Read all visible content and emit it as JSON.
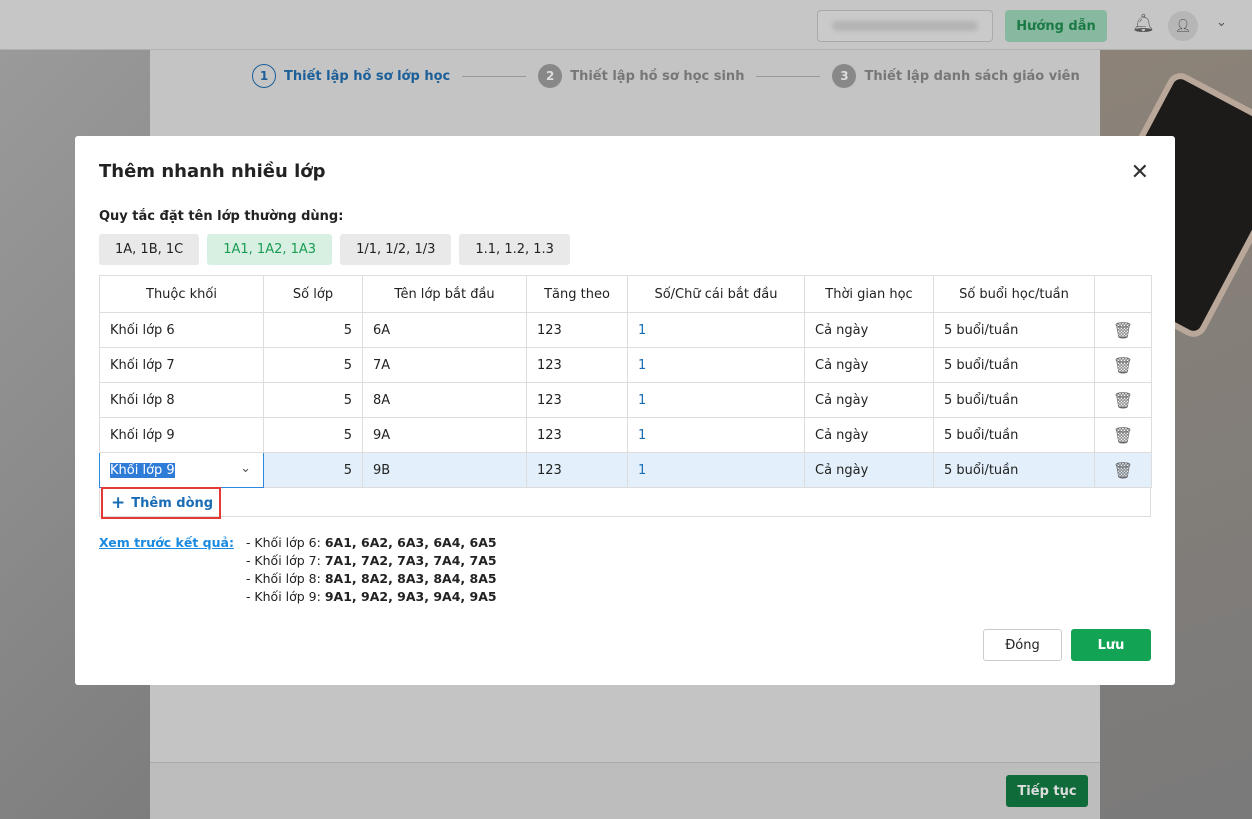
{
  "topbar": {
    "guide": "Hướng dẫn"
  },
  "steps": [
    {
      "n": "1",
      "label": "Thiết lập hồ sơ lớp học"
    },
    {
      "n": "2",
      "label": "Thiết lập hồ sơ học sinh"
    },
    {
      "n": "3",
      "label": "Thiết lập danh sách giáo viên"
    }
  ],
  "footer": {
    "next": "Tiếp tục"
  },
  "dialog": {
    "title": "Thêm nhanh nhiều lớp",
    "close": "✕",
    "rule_label": "Quy tắc đặt tên lớp thường dùng:",
    "presets": [
      "1A, 1B, 1C",
      "1A1, 1A2, 1A3",
      "1/1, 1/2, 1/3",
      "1.1, 1.2, 1.3"
    ],
    "headers": [
      "Thuộc khối",
      "Số lớp",
      "Tên lớp bắt đầu",
      "Tăng theo",
      "Số/Chữ cái bắt đầu",
      "Thời gian học",
      "Số buổi học/tuần"
    ],
    "rows": [
      [
        "Khối lớp 6",
        "5",
        "6A",
        "123",
        "1",
        "Cả ngày",
        "5 buổi/tuần"
      ],
      [
        "Khối lớp 7",
        "5",
        "7A",
        "123",
        "1",
        "Cả ngày",
        "5 buổi/tuần"
      ],
      [
        "Khối lớp 8",
        "5",
        "8A",
        "123",
        "1",
        "Cả ngày",
        "5 buổi/tuần"
      ],
      [
        "Khối lớp 9",
        "5",
        "9A",
        "123",
        "1",
        "Cả ngày",
        "5 buổi/tuần"
      ],
      [
        "Khối lớp 9",
        "5",
        "9B",
        "123",
        "1",
        "Cả ngày",
        "5 buổi/tuần"
      ]
    ],
    "add_row": "Thêm dòng",
    "preview_link": "Xem trước kết quả:",
    "preview": [
      {
        "k": "- Khối lớp 6: ",
        "v": "6A1, 6A2, 6A3, 6A4, 6A5"
      },
      {
        "k": "- Khối lớp 7: ",
        "v": "7A1, 7A2, 7A3, 7A4, 7A5"
      },
      {
        "k": "- Khối lớp 8: ",
        "v": "8A1, 8A2, 8A3, 8A4, 8A5"
      },
      {
        "k": "- Khối lớp 9: ",
        "v": "9A1, 9A2, 9A3, 9A4, 9A5"
      }
    ],
    "cancel": "Đóng",
    "save": "Lưu"
  }
}
